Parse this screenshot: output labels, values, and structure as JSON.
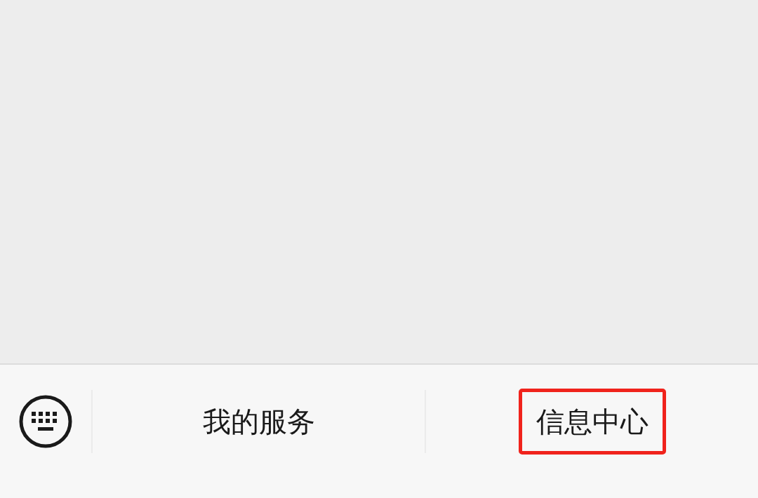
{
  "menu_bar": {
    "items": [
      {
        "label": "我的服务",
        "highlighted": false
      },
      {
        "label": "信息中心",
        "highlighted": true
      }
    ]
  }
}
